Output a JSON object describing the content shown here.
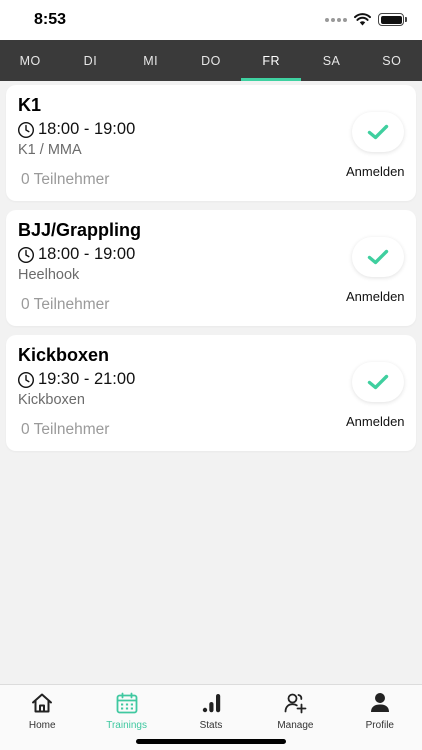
{
  "status_bar": {
    "time": "8:53",
    "icons": [
      "signal-dots-icon",
      "wifi-icon",
      "battery-icon"
    ]
  },
  "day_tabs": [
    {
      "label": "MO",
      "active": false
    },
    {
      "label": "DI",
      "active": false
    },
    {
      "label": "MI",
      "active": false
    },
    {
      "label": "DO",
      "active": false
    },
    {
      "label": "FR",
      "active": true
    },
    {
      "label": "SA",
      "active": false
    },
    {
      "label": "SO",
      "active": false
    }
  ],
  "trainings": [
    {
      "title": "K1",
      "time": "18:00 - 19:00",
      "category": "K1 / MMA",
      "participants": "0 Teilnehmer",
      "action_label": "Anmelden"
    },
    {
      "title": "BJJ/Grappling",
      "time": "18:00 - 19:00",
      "category": "Heelhook",
      "participants": "0 Teilnehmer",
      "action_label": "Anmelden"
    },
    {
      "title": "Kickboxen",
      "time": "19:30 - 21:00",
      "category": "Kickboxen",
      "participants": "0 Teilnehmer",
      "action_label": "Anmelden"
    }
  ],
  "bottom_nav": [
    {
      "label": "Home",
      "icon": "home-icon",
      "active": false
    },
    {
      "label": "Trainings",
      "icon": "calendar-icon",
      "active": true
    },
    {
      "label": "Stats",
      "icon": "stats-icon",
      "active": false
    },
    {
      "label": "Manage",
      "icon": "add-user-icon",
      "active": false
    },
    {
      "label": "Profile",
      "icon": "profile-icon",
      "active": false
    }
  ],
  "colors": {
    "accent": "#3fd1a1",
    "tab_bar": "#3a3a3a",
    "background": "#f2f2f2",
    "check": "#3fcf9f"
  }
}
